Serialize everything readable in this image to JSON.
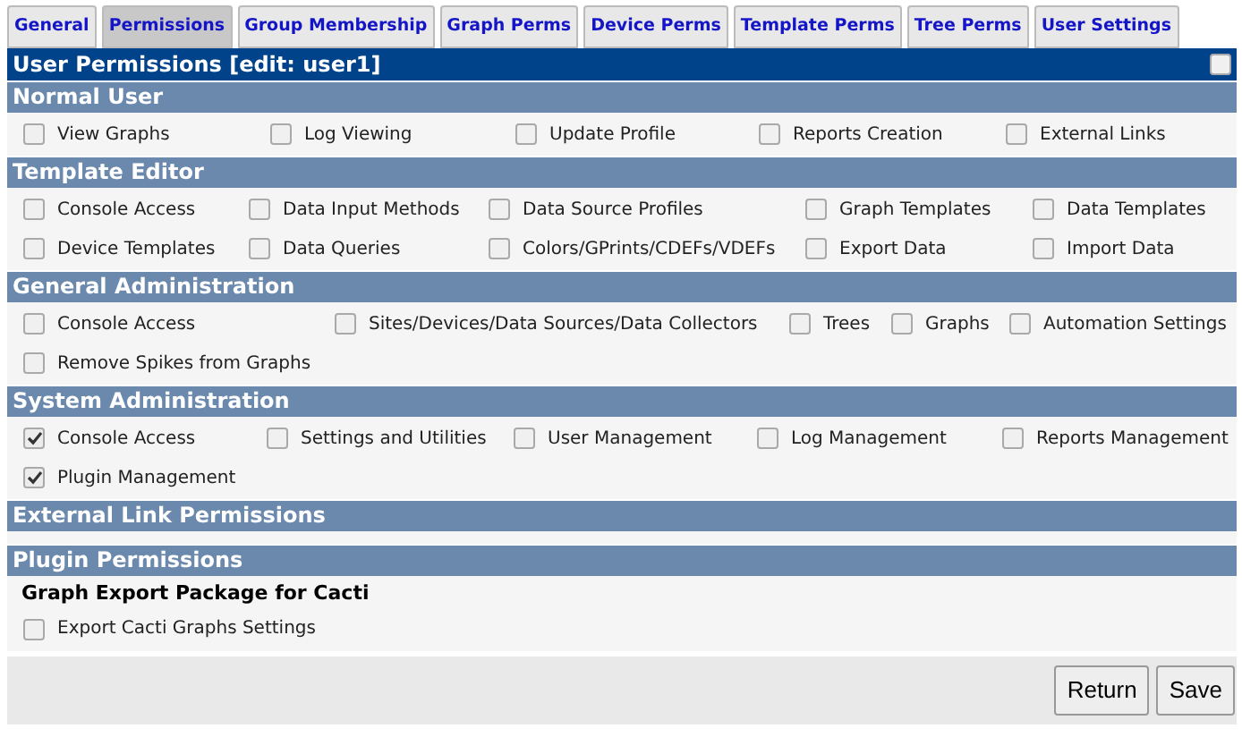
{
  "tabs": [
    {
      "label": "General",
      "selected": false
    },
    {
      "label": "Permissions",
      "selected": true
    },
    {
      "label": "Group Membership",
      "selected": false
    },
    {
      "label": "Graph Perms",
      "selected": false
    },
    {
      "label": "Device Perms",
      "selected": false
    },
    {
      "label": "Template Perms",
      "selected": false
    },
    {
      "label": "Tree Perms",
      "selected": false
    },
    {
      "label": "User Settings",
      "selected": false
    }
  ],
  "panel": {
    "title": "User Permissions [edit: user1]",
    "select_all_checked": false
  },
  "sections": [
    {
      "title": "Normal User",
      "items": [
        {
          "label": "View Graphs",
          "checked": false
        },
        {
          "label": "Log Viewing",
          "checked": false
        },
        {
          "label": "Update Profile",
          "checked": false
        },
        {
          "label": "Reports Creation",
          "checked": false
        },
        {
          "label": "External Links",
          "checked": false
        }
      ]
    },
    {
      "title": "Template Editor",
      "items": [
        {
          "label": "Console Access",
          "checked": false
        },
        {
          "label": "Data Input Methods",
          "checked": false
        },
        {
          "label": "Data Source Profiles",
          "checked": false
        },
        {
          "label": "Graph Templates",
          "checked": false
        },
        {
          "label": "Data Templates",
          "checked": false
        },
        {
          "label": "Device Templates",
          "checked": false
        },
        {
          "label": "Data Queries",
          "checked": false
        },
        {
          "label": "Colors/GPrints/CDEFs/VDEFs",
          "checked": false
        },
        {
          "label": "Export Data",
          "checked": false
        },
        {
          "label": "Import Data",
          "checked": false
        }
      ]
    },
    {
      "title": "General Administration",
      "items": [
        {
          "label": "Console Access",
          "checked": false
        },
        {
          "label": "Sites/Devices/Data Sources/Data Collectors",
          "checked": false
        },
        {
          "label": "Trees",
          "checked": false
        },
        {
          "label": "Graphs",
          "checked": false
        },
        {
          "label": "Automation Settings",
          "checked": false
        },
        {
          "label": "Remove Spikes from Graphs",
          "checked": false
        }
      ]
    },
    {
      "title": "System Administration",
      "items": [
        {
          "label": "Console Access",
          "checked": true
        },
        {
          "label": "Settings and Utilities",
          "checked": false
        },
        {
          "label": "User Management",
          "checked": false
        },
        {
          "label": "Log Management",
          "checked": false
        },
        {
          "label": "Reports Management",
          "checked": false
        },
        {
          "label": "Plugin Management",
          "checked": true
        }
      ]
    },
    {
      "title": "External Link Permissions"
    },
    {
      "title": "Plugin Permissions",
      "groups": [
        {
          "title": "Graph Export Package for Cacti",
          "items": [
            {
              "label": "Export Cacti Graphs Settings",
              "checked": false
            }
          ]
        }
      ]
    }
  ],
  "buttons": [
    "Return",
    "Save"
  ]
}
